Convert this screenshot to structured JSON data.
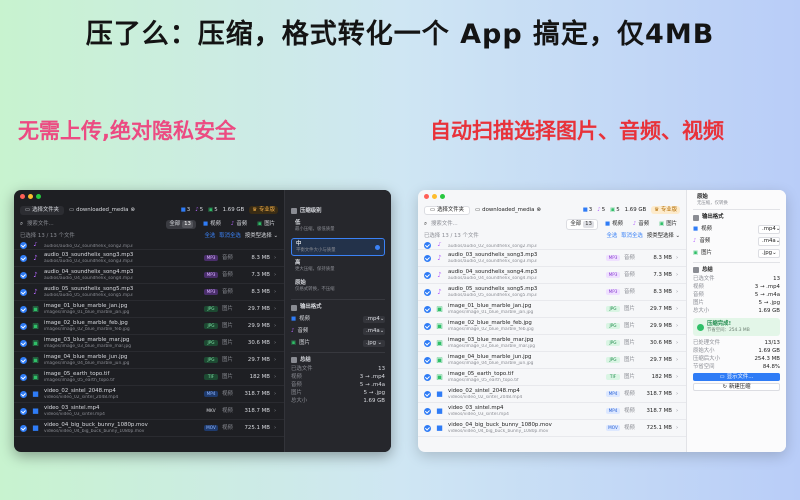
{
  "headline": "压了么：压缩，格式转化一个 App 搞定，仅4MB",
  "tagline_left": "无需上传,绝对隐私安全",
  "tagline_right": "自动扫描选择图片、音频、视频",
  "icons": {
    "folder": "folder-icon",
    "video": "video-icon",
    "music": "music-icon",
    "image": "image-icon",
    "crown": "crown-icon"
  },
  "colors": {
    "accent": "#3b82f6",
    "audio": "#b566ff",
    "image": "#2fbf68",
    "video": "#2f7cf6",
    "pro": "#f3b04a"
  },
  "dark": {
    "toolbar": {
      "choose_folder": "选择文件夹",
      "crumb": "downloaded_media",
      "crumb_badge": "⊗",
      "videos": "3",
      "audios": "5",
      "images": "5",
      "size": "1.69 GB",
      "pro": "专业版"
    },
    "search_placeholder": "搜索文件...",
    "tabs": [
      {
        "label": "全部",
        "count": "13"
      },
      {
        "label": "视频",
        "count": ""
      },
      {
        "label": "音频",
        "count": ""
      },
      {
        "label": "图片",
        "count": ""
      }
    ],
    "selection": {
      "text": "已选择 13 / 13 个文件",
      "select_all": "全选",
      "deselect": "取消全选",
      "by_type": "按类型选择 ⌄"
    },
    "files": [
      {
        "kind": "audio",
        "name": "",
        "path": "audios/audio_02_soundhelix_song2.mp3",
        "badge": "",
        "type": "",
        "size": "",
        "cut": true
      },
      {
        "kind": "audio",
        "name": "audio_03_soundhelix_song3.mp3",
        "path": "audios/audio_03_soundhelix_song3.mp3",
        "badge": "MP3",
        "type": "音频",
        "size": "8.3 MB"
      },
      {
        "kind": "audio",
        "name": "audio_04_soundhelix_song4.mp3",
        "path": "audios/audio_04_soundhelix_song4.mp3",
        "badge": "MP3",
        "type": "音频",
        "size": "7.3 MB"
      },
      {
        "kind": "audio",
        "name": "audio_05_soundhelix_song5.mp3",
        "path": "audios/audio_05_soundhelix_song5.mp3",
        "badge": "MP3",
        "type": "音频",
        "size": "8.3 MB"
      },
      {
        "kind": "image",
        "name": "image_01_blue_marble_jan.jpg",
        "path": "images/image_01_blue_marble_jan.jpg",
        "badge": "JPG",
        "type": "图片",
        "size": "29.7 MB"
      },
      {
        "kind": "image",
        "name": "image_02_blue_marble_feb.jpg",
        "path": "images/image_02_blue_marble_feb.jpg",
        "badge": "JPG",
        "type": "图片",
        "size": "29.9 MB"
      },
      {
        "kind": "image",
        "name": "image_03_blue_marble_mar.jpg",
        "path": "images/image_03_blue_marble_mar.jpg",
        "badge": "JPG",
        "type": "图片",
        "size": "30.6 MB"
      },
      {
        "kind": "image",
        "name": "image_04_blue_marble_jun.jpg",
        "path": "images/image_04_blue_marble_jun.jpg",
        "badge": "JPG",
        "type": "图片",
        "size": "29.7 MB"
      },
      {
        "kind": "image",
        "name": "image_05_earth_topo.tif",
        "path": "images/image_05_earth_topo.tif",
        "badge": "TIF",
        "type": "图片",
        "size": "182 MB"
      },
      {
        "kind": "video",
        "name": "video_02_sintel_2048.mp4",
        "path": "videos/video_02_sintel_2048.mp4",
        "badge": "MP4",
        "type": "视频",
        "size": "318.7 MB"
      },
      {
        "kind": "video",
        "name": "video_03_sintel.mp4",
        "path": "videos/video_03_sintel.mp4",
        "badge": "MKV",
        "type": "视频",
        "size": "318.7 MB"
      },
      {
        "kind": "video",
        "name": "video_04_big_buck_bunny_1080p.mov",
        "path": "videos/video_04_big_buck_bunny_1080p.mov",
        "badge": "MOV",
        "type": "视频",
        "size": "725.1 MB"
      }
    ],
    "side": {
      "level_title": "压缩级别",
      "levels": [
        {
          "title": "低",
          "desc": "最小压缩，极低质量"
        },
        {
          "title": "中",
          "desc": "平衡文件大小与质量",
          "active": true
        },
        {
          "title": "高",
          "desc": "更大压缩，保持质量"
        },
        {
          "title": "原始",
          "desc": "仅格式转换，不压缩"
        }
      ],
      "format_title": "输出格式",
      "formats": [
        {
          "label": "视频",
          "value": ".mp4"
        },
        {
          "label": "音频",
          "value": ".m4a"
        },
        {
          "label": "图片",
          "value": ".jpg"
        }
      ],
      "summary_title": "总结",
      "summary": [
        {
          "k": "已选文件",
          "v": "13"
        },
        {
          "k": "视频",
          "v": "3 → .mp4"
        },
        {
          "k": "音频",
          "v": "5 → .m4a"
        },
        {
          "k": "图片",
          "v": "5 → .jpg"
        },
        {
          "k": "总大小",
          "v": "1.69 GB"
        }
      ]
    }
  },
  "light": {
    "toolbar": {
      "choose_folder": "选择文件夹",
      "crumb": "downloaded_media",
      "crumb_badge": "⊗",
      "videos": "3",
      "audios": "5",
      "images": "5",
      "size": "1.69 GB",
      "pro": "专业版"
    },
    "search_placeholder": "搜索文件...",
    "tabs": [
      {
        "label": "全部",
        "count": "13"
      },
      {
        "label": "视频",
        "count": ""
      },
      {
        "label": "音频",
        "count": ""
      },
      {
        "label": "图片",
        "count": ""
      }
    ],
    "selection": {
      "text": "已选择 13 / 13 个文件",
      "select_all": "全选",
      "deselect": "取消全选",
      "by_type": "按类型选择 ⌄"
    },
    "files": [
      {
        "kind": "audio",
        "name": "",
        "path": "audios/audio_02_soundhelix_song2.mp3",
        "badge": "",
        "type": "",
        "size": "",
        "cut": true
      },
      {
        "kind": "audio",
        "name": "audio_03_soundhelix_song3.mp3",
        "path": "audios/audio_03_soundhelix_song3.mp3",
        "badge": "MP3",
        "type": "音频",
        "size": "8.3 MB"
      },
      {
        "kind": "audio",
        "name": "audio_04_soundhelix_song4.mp3",
        "path": "audios/audio_04_soundhelix_song4.mp3",
        "badge": "MP3",
        "type": "音频",
        "size": "7.3 MB"
      },
      {
        "kind": "audio",
        "name": "audio_05_soundhelix_song5.mp3",
        "path": "audios/audio_05_soundhelix_song5.mp3",
        "badge": "MP3",
        "type": "音频",
        "size": "8.3 MB"
      },
      {
        "kind": "image",
        "name": "image_01_blue_marble_jan.jpg",
        "path": "images/image_01_blue_marble_jan.jpg",
        "badge": "JPG",
        "type": "图片",
        "size": "29.7 MB"
      },
      {
        "kind": "image",
        "name": "image_02_blue_marble_feb.jpg",
        "path": "images/image_02_blue_marble_feb.jpg",
        "badge": "JPG",
        "type": "图片",
        "size": "29.9 MB"
      },
      {
        "kind": "image",
        "name": "image_03_blue_marble_mar.jpg",
        "path": "images/image_03_blue_marble_mar.jpg",
        "badge": "JPG",
        "type": "图片",
        "size": "30.6 MB"
      },
      {
        "kind": "image",
        "name": "image_04_blue_marble_jun.jpg",
        "path": "images/image_04_blue_marble_jun.jpg",
        "badge": "JPG",
        "type": "图片",
        "size": "29.7 MB"
      },
      {
        "kind": "image",
        "name": "image_05_earth_topo.tif",
        "path": "images/image_05_earth_topo.tif",
        "badge": "TIF",
        "type": "图片",
        "size": "182 MB"
      },
      {
        "kind": "video",
        "name": "video_02_sintel_2048.mp4",
        "path": "videos/video_02_sintel_2048.mp4",
        "badge": "MP4",
        "type": "视频",
        "size": "318.7 MB"
      },
      {
        "kind": "video",
        "name": "video_03_sintel.mp4",
        "path": "videos/video_03_sintel.mp4",
        "badge": "MP4",
        "type": "视频",
        "size": "318.7 MB"
      },
      {
        "kind": "video",
        "name": "video_04_big_buck_bunny_1080p.mov",
        "path": "videos/video_04_big_buck_bunny_1080p.mov",
        "badge": "MOV",
        "type": "视频",
        "size": "725.1 MB"
      }
    ],
    "side": {
      "level_title": "原始",
      "level_desc": "无压缩，仅转换",
      "format_title": "输出格式",
      "formats": [
        {
          "label": "视频",
          "value": ".mp4"
        },
        {
          "label": "音频",
          "value": ".m4a"
        },
        {
          "label": "图片",
          "value": ".jpg"
        }
      ],
      "summary_title": "总结",
      "summary": [
        {
          "k": "已选文件",
          "v": "13"
        },
        {
          "k": "视频",
          "v": "3 → .mp4"
        },
        {
          "k": "音频",
          "v": "5 → .m4a"
        },
        {
          "k": "图片",
          "v": "5 → .jpg"
        },
        {
          "k": "总大小",
          "v": "1.69 GB"
        }
      ],
      "done_title": "压缩完成!",
      "done_desc": "节省空间：254.3 MB",
      "result": [
        {
          "k": "已处理文件",
          "v": "13/13"
        },
        {
          "k": "原始大小",
          "v": "1.69 GB"
        },
        {
          "k": "压缩后大小",
          "v": "254.3 MB"
        },
        {
          "k": "节省空间",
          "v": "84.8%"
        }
      ],
      "reveal": "显示文件...",
      "new": "新建压缩"
    }
  }
}
